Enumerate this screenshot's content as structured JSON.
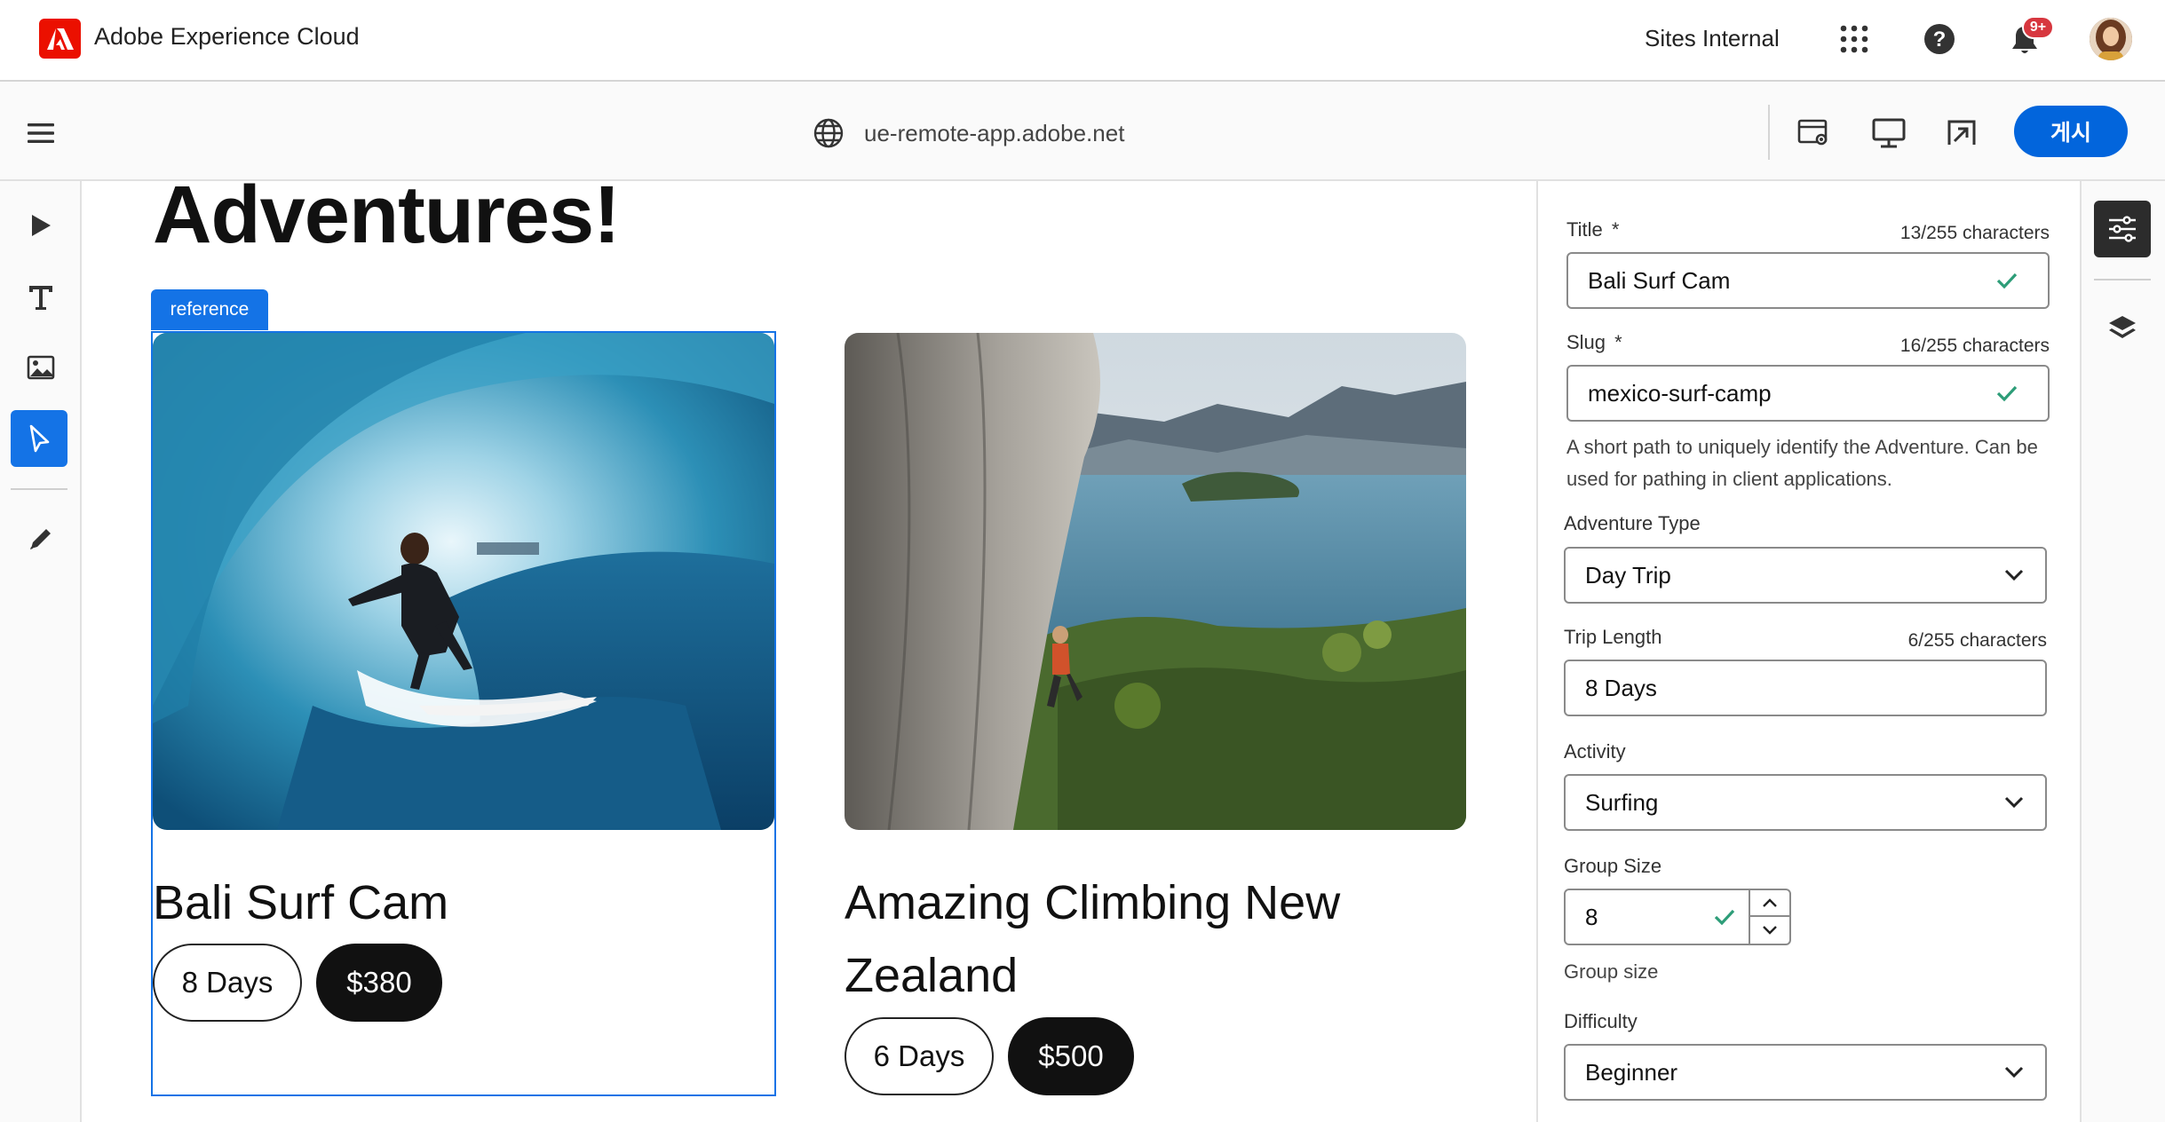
{
  "shell": {
    "app_name": "Adobe Experience Cloud",
    "org_name": "Sites Internal",
    "notification_count": "9+"
  },
  "toolbar": {
    "url": "ue-remote-app.adobe.net",
    "publish_label": "게시"
  },
  "canvas": {
    "heading": "Adventures!",
    "reference_tag": "reference",
    "cards": [
      {
        "title": "Bali Surf Cam",
        "days": "8 Days",
        "price": "$380",
        "image": "surfer-in-wave-photo"
      },
      {
        "title": "Amazing Climbing New Zealand",
        "days": "6 Days",
        "price": "$500",
        "image": "climber-on-cliff-lake-photo"
      }
    ]
  },
  "panel": {
    "title": {
      "label": "Title",
      "required": "*",
      "count": "13/255 characters",
      "value": "Bali Surf Cam"
    },
    "slug": {
      "label": "Slug",
      "required": "*",
      "count": "16/255 characters",
      "value": "mexico-surf-camp",
      "help": "A short path to uniquely identify the Adventure. Can be used for pathing in client applications."
    },
    "adventure_type": {
      "label": "Adventure Type",
      "value": "Day Trip"
    },
    "trip_length": {
      "label": "Trip Length",
      "count": "6/255 characters",
      "value": "8 Days"
    },
    "activity": {
      "label": "Activity",
      "value": "Surfing"
    },
    "group_size": {
      "label": "Group Size",
      "value": "8",
      "help": "Group size"
    },
    "difficulty": {
      "label": "Difficulty",
      "value": "Beginner"
    }
  },
  "colors": {
    "adobe_red": "#eb1000",
    "accent_blue": "#1473e6",
    "publish_blue": "#0265dc",
    "valid_green": "#2d9d78"
  }
}
